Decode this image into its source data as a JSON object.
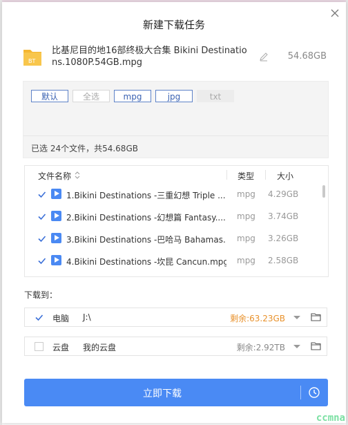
{
  "dialog": {
    "title": "新建下载任务",
    "file_name": "比基尼目的地16部终极大合集 Bikini Destinations.1080P.54GB.mpg",
    "file_badge": "BT",
    "total_size": "54.68GB"
  },
  "filters": {
    "chips": [
      "默认",
      "全选",
      "mpg",
      "jpg",
      "txt"
    ],
    "selected_info": "已选 24个文件，共54.68GB"
  },
  "table": {
    "headers": {
      "name": "文件名称",
      "type": "类型",
      "size": "大小"
    },
    "rows": [
      {
        "name": "1.Bikini Destinations -三重幻想 Triple ...",
        "type": "mpg",
        "size": "4.29GB",
        "checked": true
      },
      {
        "name": "2.Bikini Destinations -幻想篇 Fantasy....",
        "type": "mpg",
        "size": "3.74GB",
        "checked": true
      },
      {
        "name": "3.Bikini Destinations -巴哈马 Bahamas...",
        "type": "mpg",
        "size": "3.26GB",
        "checked": true
      },
      {
        "name": "4.Bikini Destinations -坎昆 Cancun.mpg",
        "type": "mpg",
        "size": "2.58GB",
        "checked": true
      }
    ]
  },
  "destination": {
    "label": "下载到：",
    "options": [
      {
        "name": "电脑",
        "path": "J:\\",
        "free": "剩余:63.23GB",
        "checked": true,
        "free_color": "#e8912b"
      },
      {
        "name": "云盘",
        "path": "我的云盘",
        "free": "剩余:2.92TB",
        "checked": false,
        "free_color": "#888888"
      }
    ]
  },
  "actions": {
    "download_now": "立即下载"
  },
  "watermark": "ccmna",
  "colors": {
    "accent": "#4a8af4",
    "free_space": "#e8912b"
  }
}
